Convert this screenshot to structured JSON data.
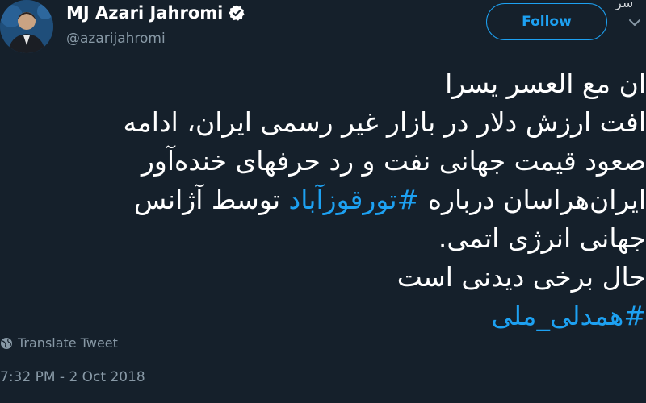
{
  "user": {
    "display_name": "MJ Azari Jahromi",
    "handle": "@azarijahromi",
    "follow_label": "Follow"
  },
  "tweet": {
    "line1": "ان مع العسر يسرا",
    "line2": "افت ارزش دلار در بازار غیر رسمی ایران، ادامه",
    "line3": "صعود قیمت جهانی نفت و رد حرفهای خنده‌آور",
    "line4_pre": "ایران‌هراسان درباره ",
    "line4_hashtag": "#تورقوزآباد",
    "line4_post": " توسط آژانس",
    "line5": "جهانی انرژی اتمی.",
    "line6": "حال برخی دیدنی است",
    "line7_hashtag": "#همدلی_ملی",
    "translate_label": "Translate Tweet",
    "timestamp": "7:32 PM - 2 Oct 2018"
  },
  "corner_text": "سر",
  "colors": {
    "background": "#15202b",
    "accent": "#1da1f2",
    "secondary_text": "#8899a6"
  },
  "icons": [
    "verified-badge-icon",
    "caret-down-icon",
    "globe-icon"
  ]
}
